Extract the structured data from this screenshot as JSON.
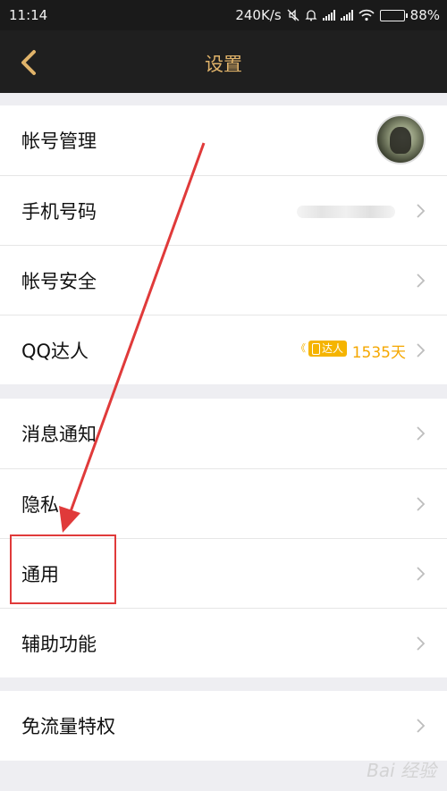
{
  "status_bar": {
    "time": "11:14",
    "speed": "240K/s",
    "battery_percent": "88%",
    "battery_level": 0.88
  },
  "nav": {
    "title": "设置"
  },
  "sections": [
    {
      "items": [
        {
          "id": "account",
          "label": "帐号管理"
        },
        {
          "id": "phone",
          "label": "手机号码"
        },
        {
          "id": "security",
          "label": "帐号安全"
        },
        {
          "id": "qq-daren",
          "label": "QQ达人",
          "badge_text": "达人",
          "days_text": "1535天"
        }
      ]
    },
    {
      "items": [
        {
          "id": "notifications",
          "label": "消息通知"
        },
        {
          "id": "privacy",
          "label": "隐私"
        },
        {
          "id": "general",
          "label": "通用"
        },
        {
          "id": "accessibility",
          "label": "辅助功能"
        }
      ]
    },
    {
      "items": [
        {
          "id": "free-data",
          "label": "免流量特权"
        }
      ]
    }
  ],
  "colors": {
    "nav_bg": "#1f1f1f",
    "accent_gold": "#e0b36a",
    "badge_orange": "#f5b400",
    "annotation_red": "#e03a3a"
  },
  "icons": [
    "back-icon",
    "chevron-right-icon",
    "avatar",
    "wifi-icon",
    "signal-icon",
    "battery-icon",
    "mute-icon",
    "alarm-icon"
  ],
  "watermark": "Bai 经验"
}
